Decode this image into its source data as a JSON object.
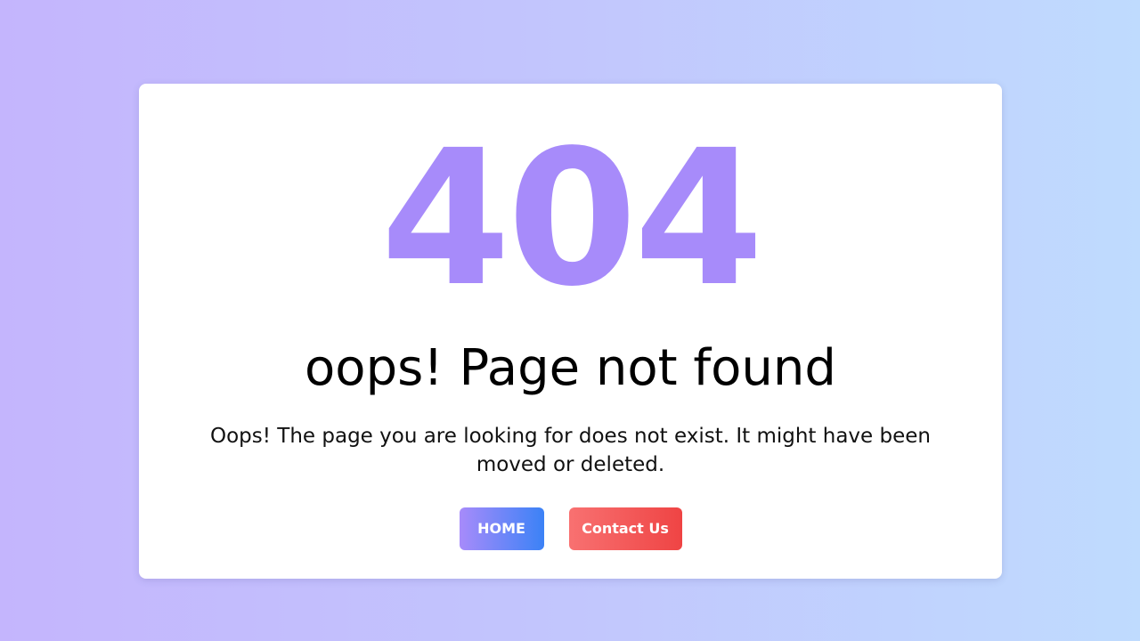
{
  "error": {
    "code": "404",
    "title": "oops! Page not found",
    "message": "Oops! The page you are looking for does not exist. It might have been moved or deleted."
  },
  "actions": {
    "home_label": "HOME",
    "contact_label": "Contact Us"
  },
  "colors": {
    "accent_purple": "#a78bfa",
    "accent_blue": "#3b82f6",
    "accent_red": "#ef4444",
    "background_start": "#c4b5fd",
    "background_end": "#bfdbfe"
  }
}
